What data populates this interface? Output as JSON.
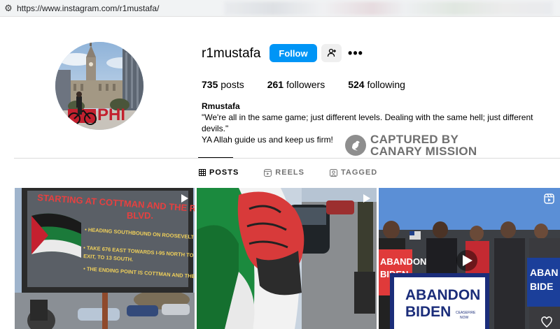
{
  "browser": {
    "url": "https://www.instagram.com/r1mustafa/"
  },
  "profile": {
    "username": "r1mustafa",
    "follow_label": "Follow",
    "full_name": "Rmustafa",
    "bio_line1": "\"We're all in the same game; just different levels. Dealing with the same hell; just different devils.\"",
    "bio_line2": "YA Allah guide us and keep us firm!",
    "stats": {
      "posts_count": "735",
      "posts_label": "posts",
      "followers_count": "261",
      "followers_label": "followers",
      "following_count": "524",
      "following_label": "following"
    }
  },
  "watermark": {
    "line1": "CAPTURED BY",
    "line2": "CANARY MISSION"
  },
  "tabs": [
    {
      "label": "POSTS",
      "icon": "grid-icon",
      "active": true
    },
    {
      "label": "REELS",
      "icon": "reels-icon",
      "active": false
    },
    {
      "label": "TAGGED",
      "icon": "tagged-icon",
      "active": false
    }
  ],
  "posts": [
    {
      "type": "video",
      "sign_line1": "STARTING AT COTTMAN AND THE ROOSEVELT",
      "sign_line2": "BLVD.",
      "sign_bullets": [
        "• HEADING SOUTHBOUND ON ROOSEVELT TO 676,",
        "• TAKE 676 EAST TOWARDS I-95 NORTH TO WOODHAVEN",
        "  EXIT, TO 13 SOUTH.",
        "• THE ENDING POINT IS COTTMAN AND THE ROOSEVELT"
      ]
    },
    {
      "type": "video"
    },
    {
      "type": "reel",
      "sign_left": [
        "ABANDON",
        "BIDEN"
      ],
      "podium_line1": "ABANDON",
      "podium_line2": "BIDEN",
      "podium_small1": "CEASEFIRE",
      "podium_small2": "NOW",
      "sign_right": [
        "ABAN",
        "BIDE"
      ]
    }
  ]
}
